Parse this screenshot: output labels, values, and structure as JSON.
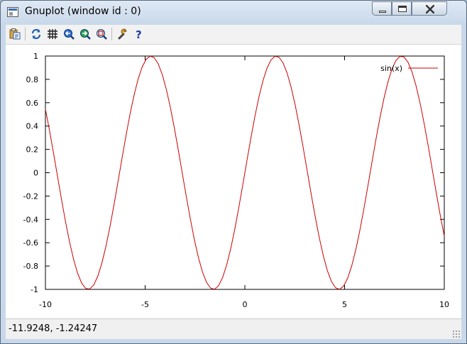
{
  "window": {
    "title": "Gnuplot (window id : 0)"
  },
  "toolbar": {
    "items": [
      {
        "name": "copy-to-clipboard-icon"
      },
      {
        "name": "replot-icon"
      },
      {
        "name": "grid-icon"
      },
      {
        "name": "zoom-previous-icon"
      },
      {
        "name": "zoom-next-icon"
      },
      {
        "name": "autoscale-icon"
      },
      {
        "name": "options-wrench-icon"
      },
      {
        "name": "help-icon"
      }
    ]
  },
  "status": {
    "coordinates": "-11.9248, -1.24247"
  },
  "colors": {
    "curve": "#cc0000",
    "axis": "#000000"
  },
  "chart_data": {
    "type": "line",
    "title": "",
    "xlabel": "",
    "ylabel": "",
    "xlim": [
      -10,
      10
    ],
    "ylim": [
      -1,
      1
    ],
    "x_ticks": [
      -10,
      -5,
      0,
      5,
      10
    ],
    "x_tick_labels": [
      "-10",
      "-5",
      "0",
      "5",
      "10"
    ],
    "y_ticks": [
      -1,
      -0.8,
      -0.6,
      -0.4,
      -0.2,
      0,
      0.2,
      0.4,
      0.6,
      0.8,
      1
    ],
    "y_tick_labels": [
      "-1",
      "-0.8",
      "-0.6",
      "-0.4",
      "-0.2",
      "0",
      "0.2",
      "0.4",
      "0.6",
      "0.8",
      "1"
    ],
    "grid": false,
    "legend_position": "top-right",
    "series": [
      {
        "name": "sin(x)",
        "function": "sin(x)",
        "color": "#cc0000",
        "sample_count": 100
      }
    ]
  }
}
